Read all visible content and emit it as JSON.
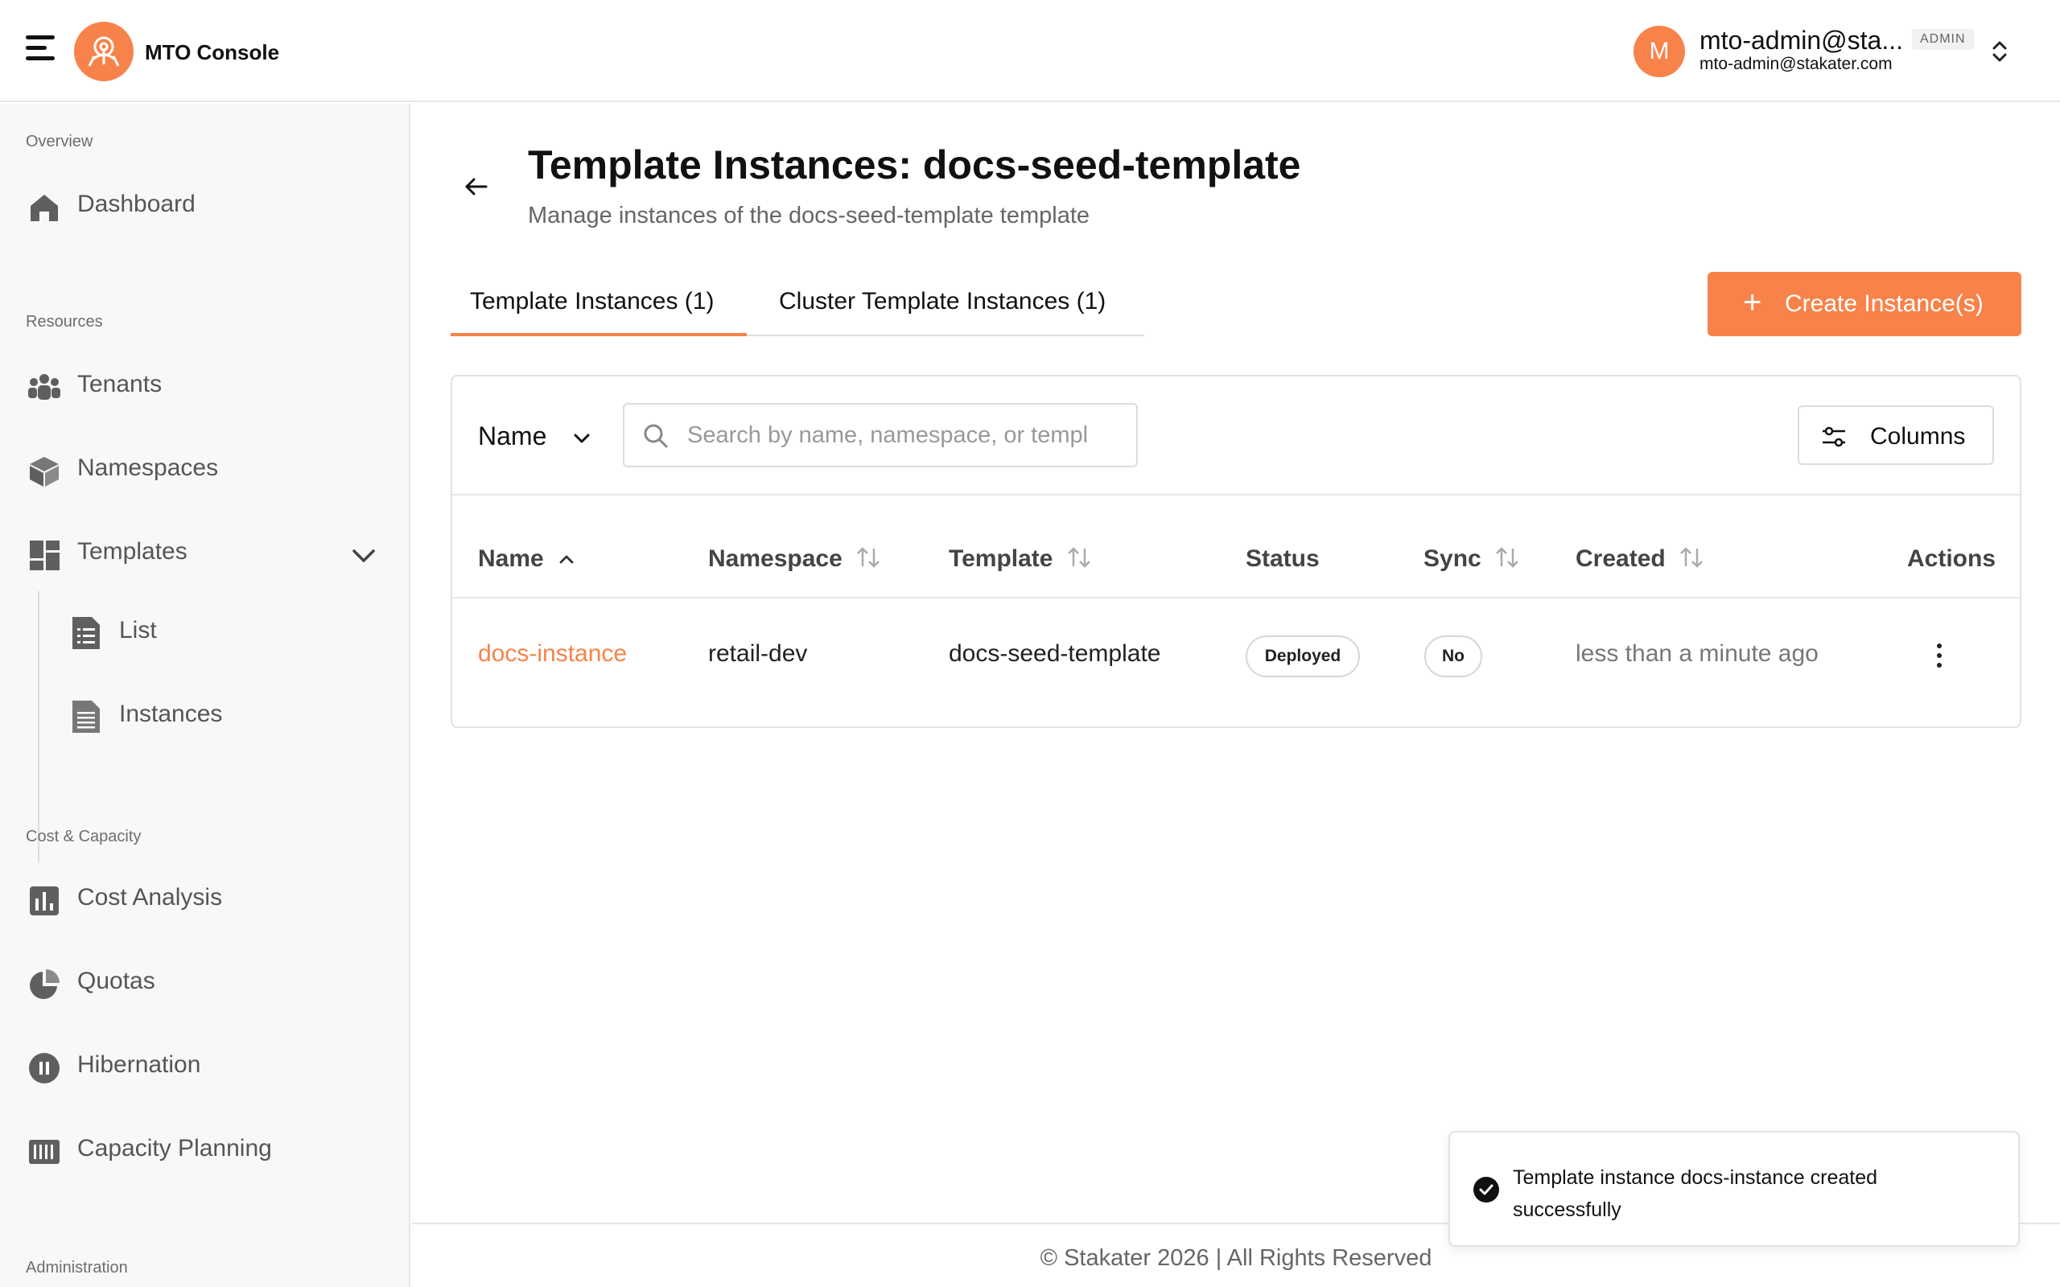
{
  "header": {
    "brand": "MTO Console",
    "user": {
      "avatar_initial": "M",
      "name": "mto-admin@sta...",
      "email": "mto-admin@stakater.com",
      "role": "ADMIN"
    }
  },
  "sidebar": {
    "sections": {
      "overview": "Overview",
      "resources": "Resources",
      "cost_capacity": "Cost & Capacity",
      "administration": "Administration"
    },
    "items": {
      "dashboard": "Dashboard",
      "tenants": "Tenants",
      "namespaces": "Namespaces",
      "templates": "Templates",
      "list": "List",
      "instances": "Instances",
      "cost_analysis": "Cost Analysis",
      "quotas": "Quotas",
      "hibernation": "Hibernation",
      "capacity_planning": "Capacity Planning"
    }
  },
  "main": {
    "title": "Template Instances: docs-seed-template",
    "subtitle": "Manage instances of the docs-seed-template template",
    "tabs": [
      {
        "label": "Template Instances (1)",
        "active": true
      },
      {
        "label": "Cluster Template Instances (1)",
        "active": false
      }
    ],
    "create_button": "Create Instance(s)",
    "filter_field": "Name",
    "search_placeholder": "Search by name, namespace, or templ",
    "columns_button": "Columns",
    "table": {
      "headers": {
        "name": "Name",
        "namespace": "Namespace",
        "template": "Template",
        "status": "Status",
        "sync": "Sync",
        "created": "Created",
        "actions": "Actions"
      },
      "rows": [
        {
          "name": "docs-instance",
          "namespace": "retail-dev",
          "template": "docs-seed-template",
          "status": "Deployed",
          "sync": "No",
          "created": "less than a minute ago"
        }
      ]
    }
  },
  "footer": "© Stakater 2026 | All Rights Reserved",
  "toast": {
    "message": "Template instance docs-instance created successfully"
  },
  "colors": {
    "accent": "#f7834a",
    "sidebar_bg": "#f8f8f8",
    "border": "#e6e6e6"
  },
  "icons": {
    "menu": "hamburger-icon",
    "logo": "stakater-logo-icon",
    "back": "arrow-left-icon",
    "search": "search-icon",
    "columns": "sliders-icon",
    "toast": "check-circle-icon"
  }
}
